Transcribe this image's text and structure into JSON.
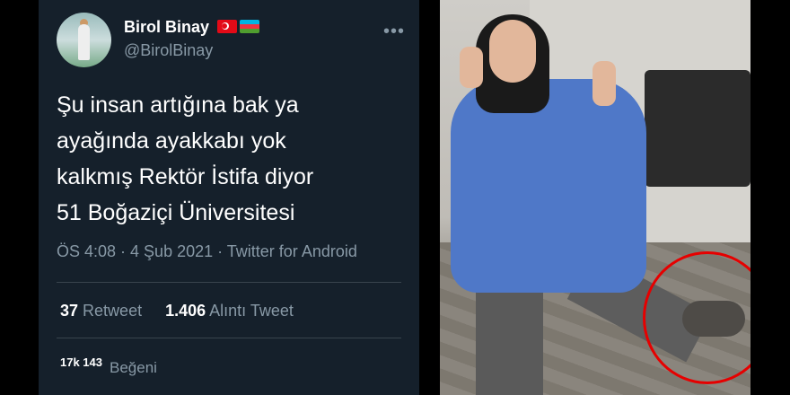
{
  "user": {
    "name": "Birol Binay",
    "handle": "@BirolBinay"
  },
  "tweet": {
    "lines": [
      "Şu insan artığına bak ya",
      "ayağında ayakkabı yok",
      "kalkmış Rektör İstifa diyor",
      "51 Boğaziçi Üniversitesi"
    ],
    "meta": "ÖS 4:08 · 4 Şub 2021 · Twitter for Android"
  },
  "stats": {
    "retweets_count": "37",
    "retweets_label": "Retweet",
    "quotes_count": "1.406",
    "quotes_label": "Alıntı Tweet",
    "likes_count": "17k 143",
    "likes_label": "Beğeni"
  },
  "icons": {
    "more": "more-horizontal-icon",
    "flag1": "turkey-flag-icon",
    "flag2": "azerbaijan-flag-icon"
  },
  "colors": {
    "background": "#15202b",
    "secondary_text": "#8899a6",
    "annotation_circle": "#e60000"
  }
}
